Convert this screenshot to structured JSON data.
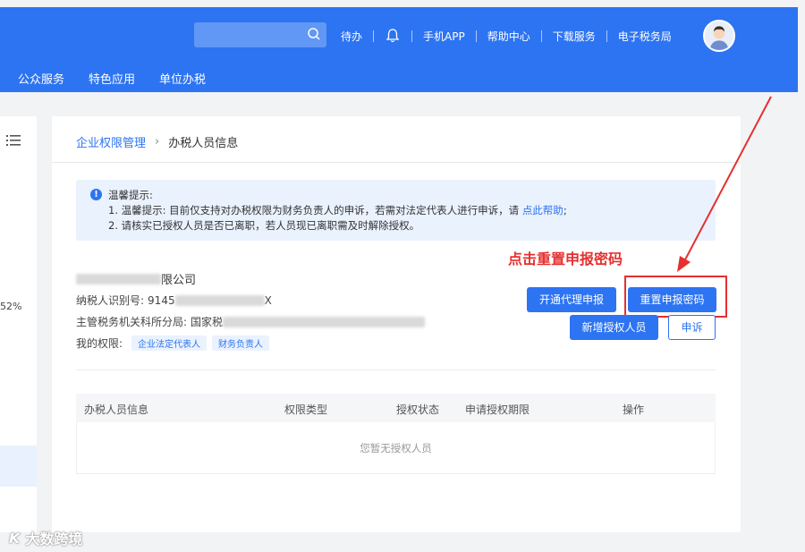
{
  "header": {
    "search": {
      "placeholder": ""
    },
    "links": [
      "待办",
      "手机APP",
      "帮助中心",
      "下载服务",
      "电子税务局"
    ],
    "nav": [
      "公众服务",
      "特色应用",
      "单位办税"
    ]
  },
  "sidebar": {
    "percent": "52%"
  },
  "breadcrumb": {
    "parent": "企业权限管理",
    "separator": "›",
    "current": "办税人员信息"
  },
  "notice": {
    "title": "温馨提示:",
    "line1_prefix": "1. 温馨提示: 目前仅支持对办税权限为财务负责人的申诉，若需对法定代表人进行申诉，请",
    "line1_link": "点此帮助",
    "line1_suffix": ";",
    "line2": "2. 请核实已授权人员是否已离职，若人员现已离职需及时解除授权。"
  },
  "annotation": "点击重置申报密码",
  "company": {
    "name_prefix": "",
    "name_suffix": "限公司",
    "taxpayer_label": "纳税人识别号:",
    "taxpayer_prefix": "9145",
    "taxpayer_suffix": "X",
    "authority_label": "主管税务机关科所分局:",
    "authority_prefix": "国家税",
    "rights_label": "我的权限:",
    "rights": [
      "企业法定代表人",
      "财务负责人"
    ]
  },
  "buttons": {
    "open_agent": "开通代理申报",
    "reset_password": "重置申报密码",
    "add_authorized": "新增授权人员",
    "appeal": "申诉"
  },
  "table": {
    "columns": [
      "办税人员信息",
      "权限类型",
      "授权状态",
      "申请授权期限",
      "操作"
    ],
    "empty_text": "您暂无授权人员"
  },
  "watermark": {
    "logo": "K",
    "text": "大数跨境"
  },
  "colors": {
    "primary": "#2d74f2",
    "annotation": "#e53030"
  },
  "icons": [
    "search-icon",
    "bell-icon",
    "avatar",
    "list-icon",
    "info-icon"
  ]
}
